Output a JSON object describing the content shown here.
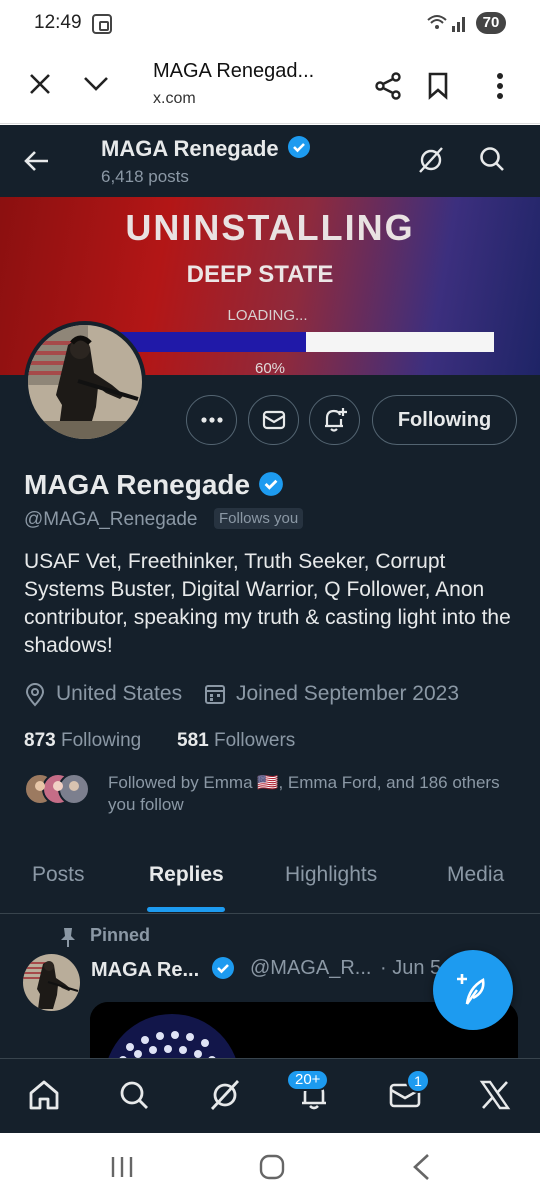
{
  "status_bar": {
    "time": "12:49",
    "battery": "70"
  },
  "browser": {
    "title": "MAGA Renegad...",
    "domain": "x.com"
  },
  "header": {
    "name": "MAGA Renegade",
    "posts": "6,418 posts"
  },
  "banner": {
    "line1": "UNINSTALLING",
    "line2": "DEEP STATE",
    "line3": "LOADING...",
    "percent_label": "60%",
    "progress": 0.5
  },
  "actions": {
    "following_label": "Following"
  },
  "profile": {
    "name": "MAGA Renegade",
    "handle": "@MAGA_Renegade",
    "follows_you": "Follows you",
    "bio": "USAF Vet, Freethinker, Truth Seeker, Corrupt Systems Buster, Digital Warrior, Q Follower, Anon contributor, speaking my truth & casting light into the shadows!",
    "location": "United States",
    "joined": "Joined September 2023",
    "following_count": "873",
    "following_label": "Following",
    "followers_count": "581",
    "followers_label": "Followers",
    "followed_by_prefix": "Followed by Emma",
    "followed_by_flag": "🇺🇸",
    "followed_by_rest": ", Emma Ford, and 186 others you follow"
  },
  "tabs": [
    {
      "label": "Posts",
      "active": false
    },
    {
      "label": "Replies",
      "active": true
    },
    {
      "label": "Highlights",
      "active": false
    },
    {
      "label": "Media",
      "active": false
    }
  ],
  "pinned_tweet": {
    "pinned_label": "Pinned",
    "name": "MAGA Re...",
    "handle": "@MAGA_R...",
    "date": "· Jun 5"
  },
  "bottom_nav": {
    "notifications_badge": "20+",
    "messages_badge": "1"
  },
  "colors": {
    "background": "#15202b",
    "accent": "#1d9bf0",
    "text": "#e7e9ea",
    "muted": "#8b98a5"
  }
}
